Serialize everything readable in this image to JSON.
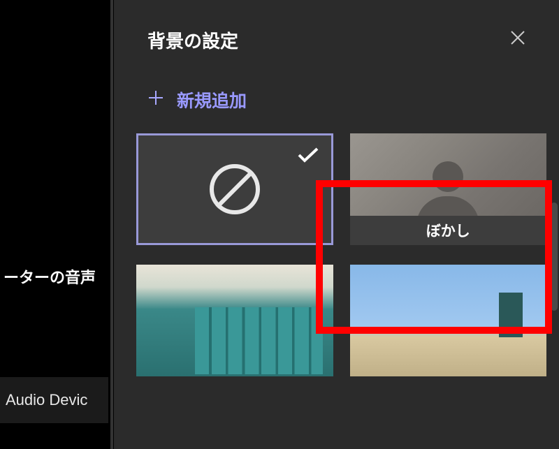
{
  "sidebar": {
    "audio_section_label": "ーターの音声",
    "audio_device": "Audio Devic"
  },
  "panel": {
    "title": "背景の設定",
    "add_new_label": "新規追加"
  },
  "backgrounds": {
    "none": {
      "selected": true
    },
    "blur": {
      "label": "ぼかし"
    }
  }
}
